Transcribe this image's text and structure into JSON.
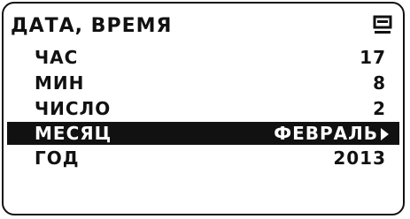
{
  "header": {
    "title": "ДАТА, ВРЕМЯ",
    "icon": "back-screen-icon"
  },
  "rows": [
    {
      "label": "ЧАС",
      "value": "17"
    },
    {
      "label": "МИН",
      "value": "8"
    },
    {
      "label": "ЧИСЛО",
      "value": "2"
    },
    {
      "label": "МЕСЯЦ",
      "value": "ФЕВРАЛЬ",
      "selected": true
    },
    {
      "label": "ГОД",
      "value": "2013"
    }
  ]
}
